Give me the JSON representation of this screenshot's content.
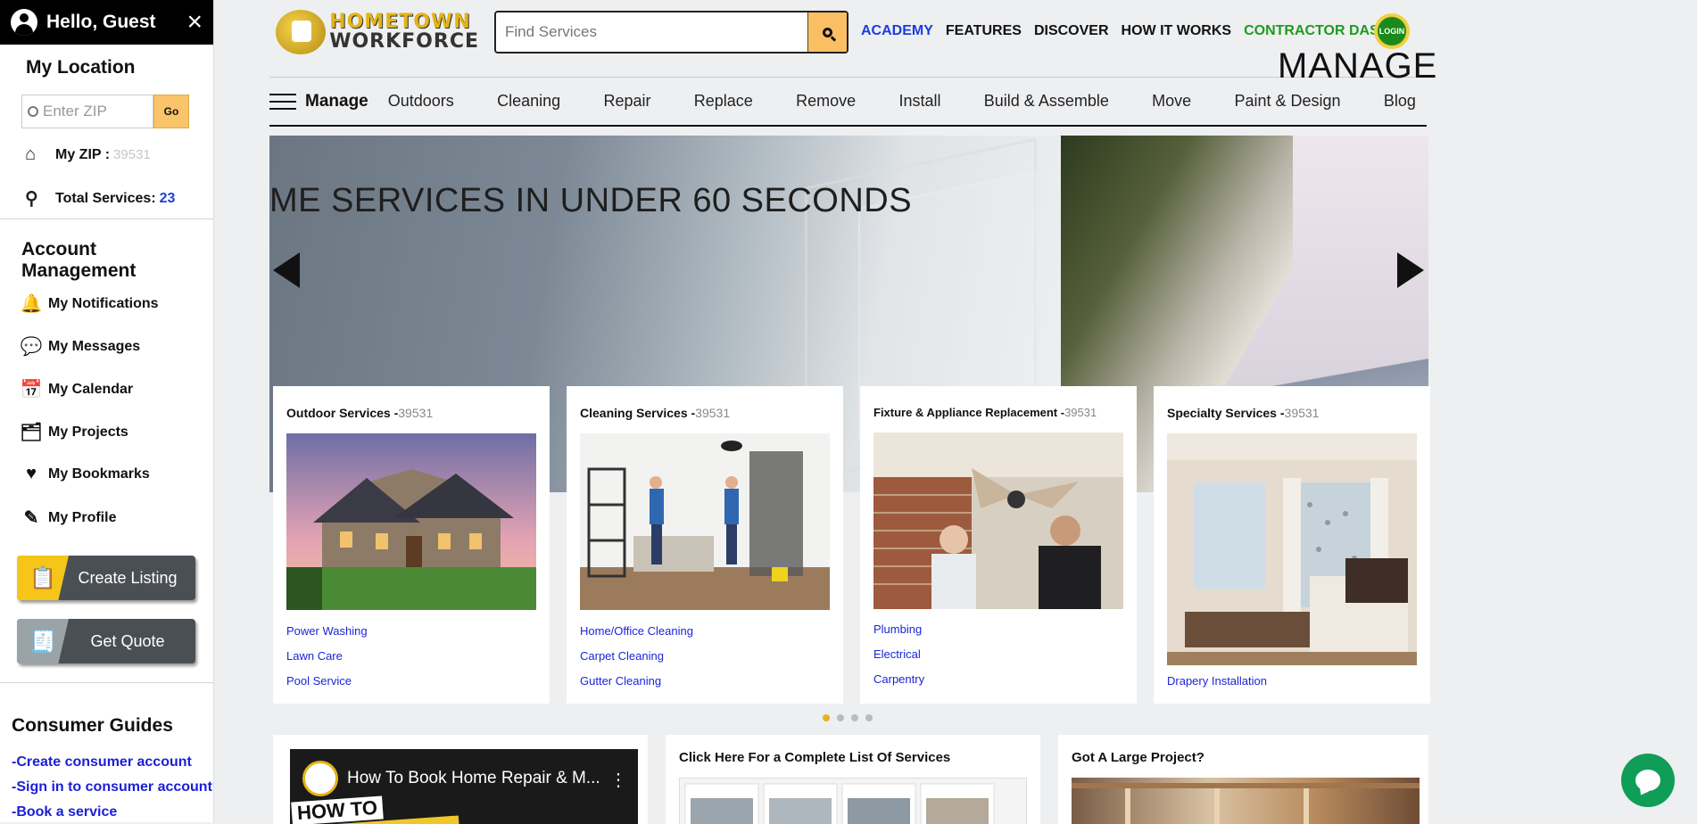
{
  "sidebar": {
    "greeting": "Hello, Guest",
    "close_icon": "×",
    "location_title": "My Location",
    "zip_placeholder": "Enter ZIP",
    "zip_go": "Go",
    "my_zip_label": "My ZIP :",
    "my_zip_value": "39531",
    "total_services_label": "Total Services:",
    "total_services_value": "23",
    "account_title": "Account Management",
    "account_items": [
      {
        "label": "My Notifications",
        "icon": "bell-icon",
        "glyph": "🔔"
      },
      {
        "label": "My Messages",
        "icon": "chat-bubbles-icon",
        "glyph": "💬"
      },
      {
        "label": "My Calendar",
        "icon": "calendar-icon",
        "glyph": "📅"
      },
      {
        "label": "My Projects",
        "icon": "projects-icon",
        "glyph": "🗂"
      },
      {
        "label": "My Bookmarks",
        "icon": "heart-icon",
        "glyph": "♥"
      },
      {
        "label": "My Profile",
        "icon": "profile-edit-icon",
        "glyph": "✎"
      }
    ],
    "create_listing": "Create Listing",
    "get_quote": "Get Quote",
    "guides_title": "Consumer Guides",
    "guides": [
      "-Create consumer account",
      "-Sign in to consumer account",
      "-Book a service"
    ]
  },
  "header": {
    "logo_line1": "HOMETOWN",
    "logo_line2": "WORKFORCE",
    "search_placeholder": "Find Services",
    "nav": [
      "ACADEMY",
      "FEATURES",
      "DISCOVER",
      "HOW IT WORKS",
      "CONTRACTOR DASH"
    ],
    "login": "LOGIN"
  },
  "catnav": {
    "manage": "Manage",
    "items": [
      "Outdoors",
      "Cleaning",
      "Repair",
      "Replace",
      "Remove",
      "Install",
      "Build & Assemble",
      "Move",
      "Paint & Design",
      "Blog"
    ]
  },
  "hero": {
    "text1": "ME SERVICES IN UNDER 60 SECONDS",
    "text2": "MANAGE"
  },
  "cards": [
    {
      "title": "Outdoor Services -",
      "zip": "39531",
      "links": [
        "Power Washing",
        "Lawn Care",
        "Pool Service"
      ]
    },
    {
      "title": "Cleaning Services -",
      "zip": "39531",
      "links": [
        "Home/Office Cleaning",
        "Carpet Cleaning",
        "Gutter Cleaning"
      ]
    },
    {
      "title": "Fixture & Appliance Replacement -",
      "zip": "39531",
      "links": [
        "Plumbing",
        "Electrical",
        "Carpentry"
      ]
    },
    {
      "title": "Specialty Services -",
      "zip": "39531",
      "links": [
        "Drapery Installation"
      ]
    }
  ],
  "carousel": {
    "dots": 4,
    "active": 1
  },
  "bottom": {
    "video_title": "How To Book Home Repair & M...",
    "video_overlay": "HOW TO",
    "list_title": "Click Here For a Complete List Of Services",
    "project_title": "Got A Large Project?"
  },
  "colors": {
    "accent_yellow": "#f9c46a",
    "link_blue": "#1b25d8",
    "chat_green": "#0f9d58"
  }
}
